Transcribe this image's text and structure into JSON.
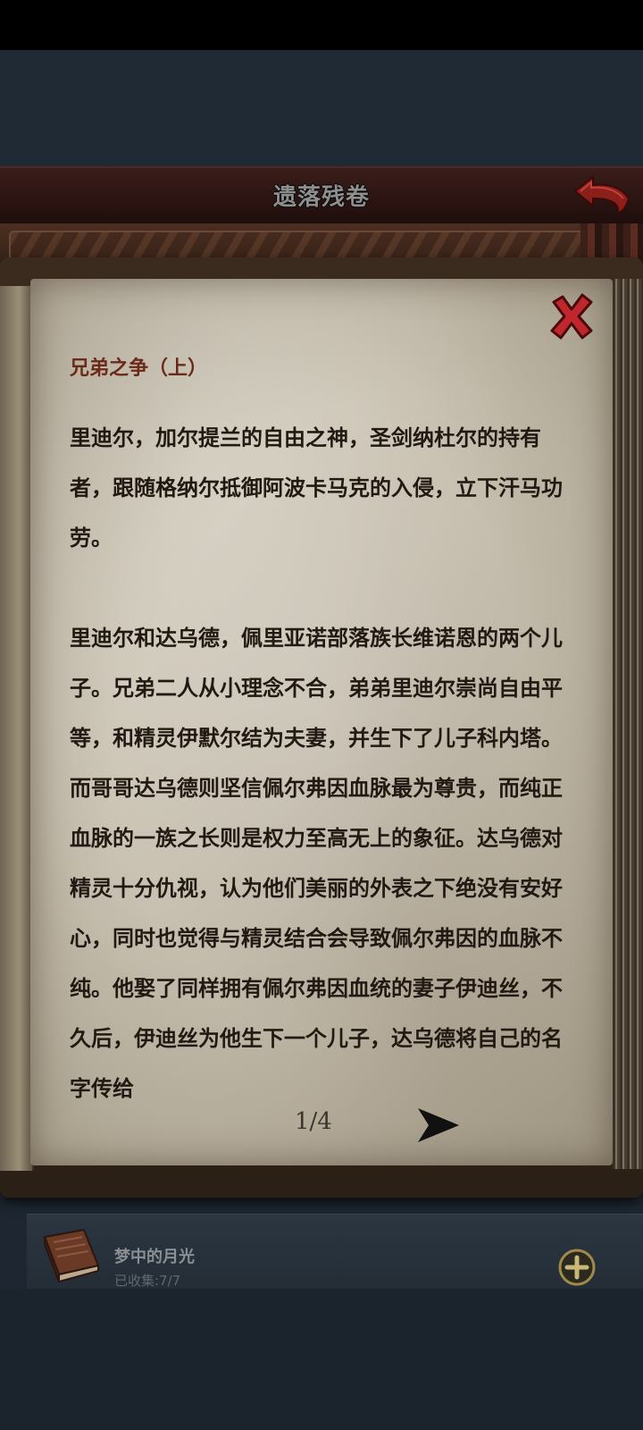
{
  "header": {
    "title": "遗落残卷"
  },
  "document": {
    "title": "兄弟之争（上）",
    "paragraphs": [
      "里迪尔，加尔提兰的自由之神，圣剑纳杜尔的持有者，跟随格纳尔抵御阿波卡马克的入侵，立下汗马功劳。",
      "里迪尔和达乌德，佩里亚诺部落族长维诺恩的两个儿子。兄弟二人从小理念不合，弟弟里迪尔崇尚自由平等，和精灵伊默尔结为夫妻，并生下了儿子科内塔。而哥哥达乌德则坚信佩尔弗因血脉最为尊贵，而纯正血脉的一族之长则是权力至高无上的象征。达乌德对精灵十分仇视，认为他们美丽的外表之下绝没有安好心，同时也觉得与精灵结合会导致佩尔弗因的血脉不纯。他娶了同样拥有佩尔弗因血统的妻子伊迪丝，不久后，伊迪丝为他生下一个儿子，达乌德将自己的名字传给"
    ],
    "page_indicator": "1/4"
  },
  "collection": {
    "name": "梦中的月光",
    "count": "已收集:7/7"
  },
  "icons": {
    "back": "back-arrow-icon",
    "close": "close-x-icon",
    "next": "next-page-arrow-icon",
    "book": "book-icon",
    "add": "plus-circle-icon"
  },
  "colors": {
    "title_text": "#6b2a18",
    "body_text": "#221a12",
    "close_red": "#c0272d"
  }
}
